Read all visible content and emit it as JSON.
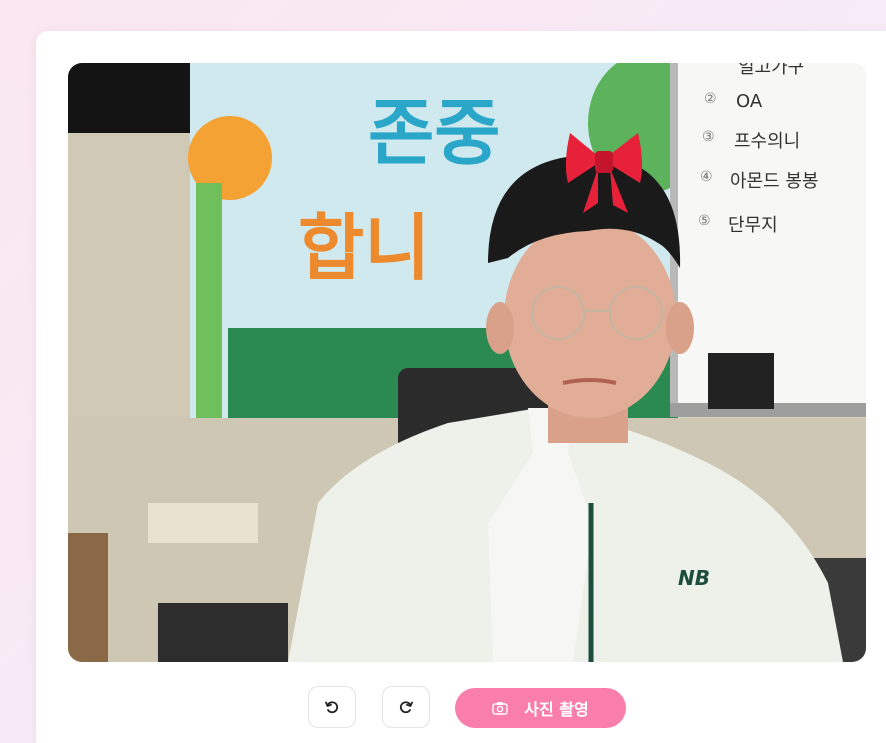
{
  "capture_button": {
    "label": "사진 촬영",
    "icon": "camera-icon"
  },
  "rotate_left_button": {
    "icon": "rotate-left-icon"
  },
  "rotate_right_button": {
    "icon": "rotate-right-icon"
  },
  "camera_view": {
    "overlay_sticker": "ribbon-bow",
    "banner_text": [
      "존중",
      "합니"
    ],
    "whiteboard_items": [
      "일고가구",
      "OA",
      "프수의니",
      "아몬드 봉봉",
      "단무지"
    ],
    "whiteboard_numbers": [
      "②",
      "③",
      "④",
      "⑤"
    ],
    "shirt_logo": "NB"
  },
  "colors": {
    "accent": "#f97faa",
    "background": "#fbe7ef",
    "bow": "#e8213a"
  }
}
